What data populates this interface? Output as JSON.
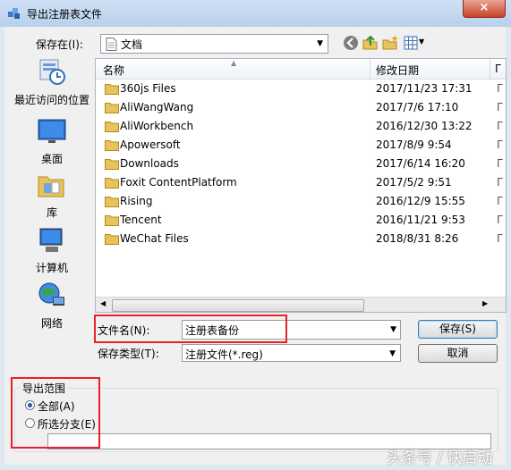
{
  "window": {
    "title": "导出注册表文件",
    "close_label": "×"
  },
  "toolbar": {
    "save_in_label": "保存在(I):",
    "location": "文档",
    "icons": [
      "back-icon",
      "up-folder-icon",
      "new-folder-icon",
      "view-menu-icon"
    ]
  },
  "places": [
    {
      "label": "最近访问的位置",
      "icon": "recent-places-icon"
    },
    {
      "label": "桌面",
      "icon": "desktop-icon"
    },
    {
      "label": "库",
      "icon": "libraries-icon"
    },
    {
      "label": "计算机",
      "icon": "computer-icon"
    },
    {
      "label": "网络",
      "icon": "network-icon"
    }
  ],
  "filelist": {
    "columns": [
      "名称",
      "修改日期",
      "Г"
    ],
    "rows": [
      {
        "name": "360js Files",
        "date": "2017/11/23 17:31",
        "cut": "Г"
      },
      {
        "name": "AliWangWang",
        "date": "2017/7/6 17:10",
        "cut": "Г"
      },
      {
        "name": "AliWorkbench",
        "date": "2016/12/30 13:22",
        "cut": "Г"
      },
      {
        "name": "Apowersoft",
        "date": "2017/8/9 9:54",
        "cut": "Г"
      },
      {
        "name": "Downloads",
        "date": "2017/6/14 16:20",
        "cut": "Г"
      },
      {
        "name": "Foxit ContentPlatform",
        "date": "2017/5/2 9:51",
        "cut": "Г"
      },
      {
        "name": "Rising",
        "date": "2016/12/9 15:55",
        "cut": "Г"
      },
      {
        "name": "Tencent",
        "date": "2016/11/21 9:53",
        "cut": "Г"
      },
      {
        "name": "WeChat Files",
        "date": "2018/8/31 8:26",
        "cut": "Г"
      }
    ]
  },
  "filename": {
    "label": "文件名(N):",
    "value": "注册表备份"
  },
  "filetype": {
    "label": "保存类型(T):",
    "value": "注册文件(*.reg)"
  },
  "buttons": {
    "save": "保存(S)",
    "cancel": "取消"
  },
  "export_range": {
    "title": "导出范围",
    "options": [
      {
        "label": "全部(A)",
        "selected": true
      },
      {
        "label": "所选分支(E)",
        "selected": false
      }
    ]
  },
  "watermark": "头条号 / 快启动",
  "colors": {
    "highlight": "#e8202a",
    "folder": "#e8c25a"
  }
}
